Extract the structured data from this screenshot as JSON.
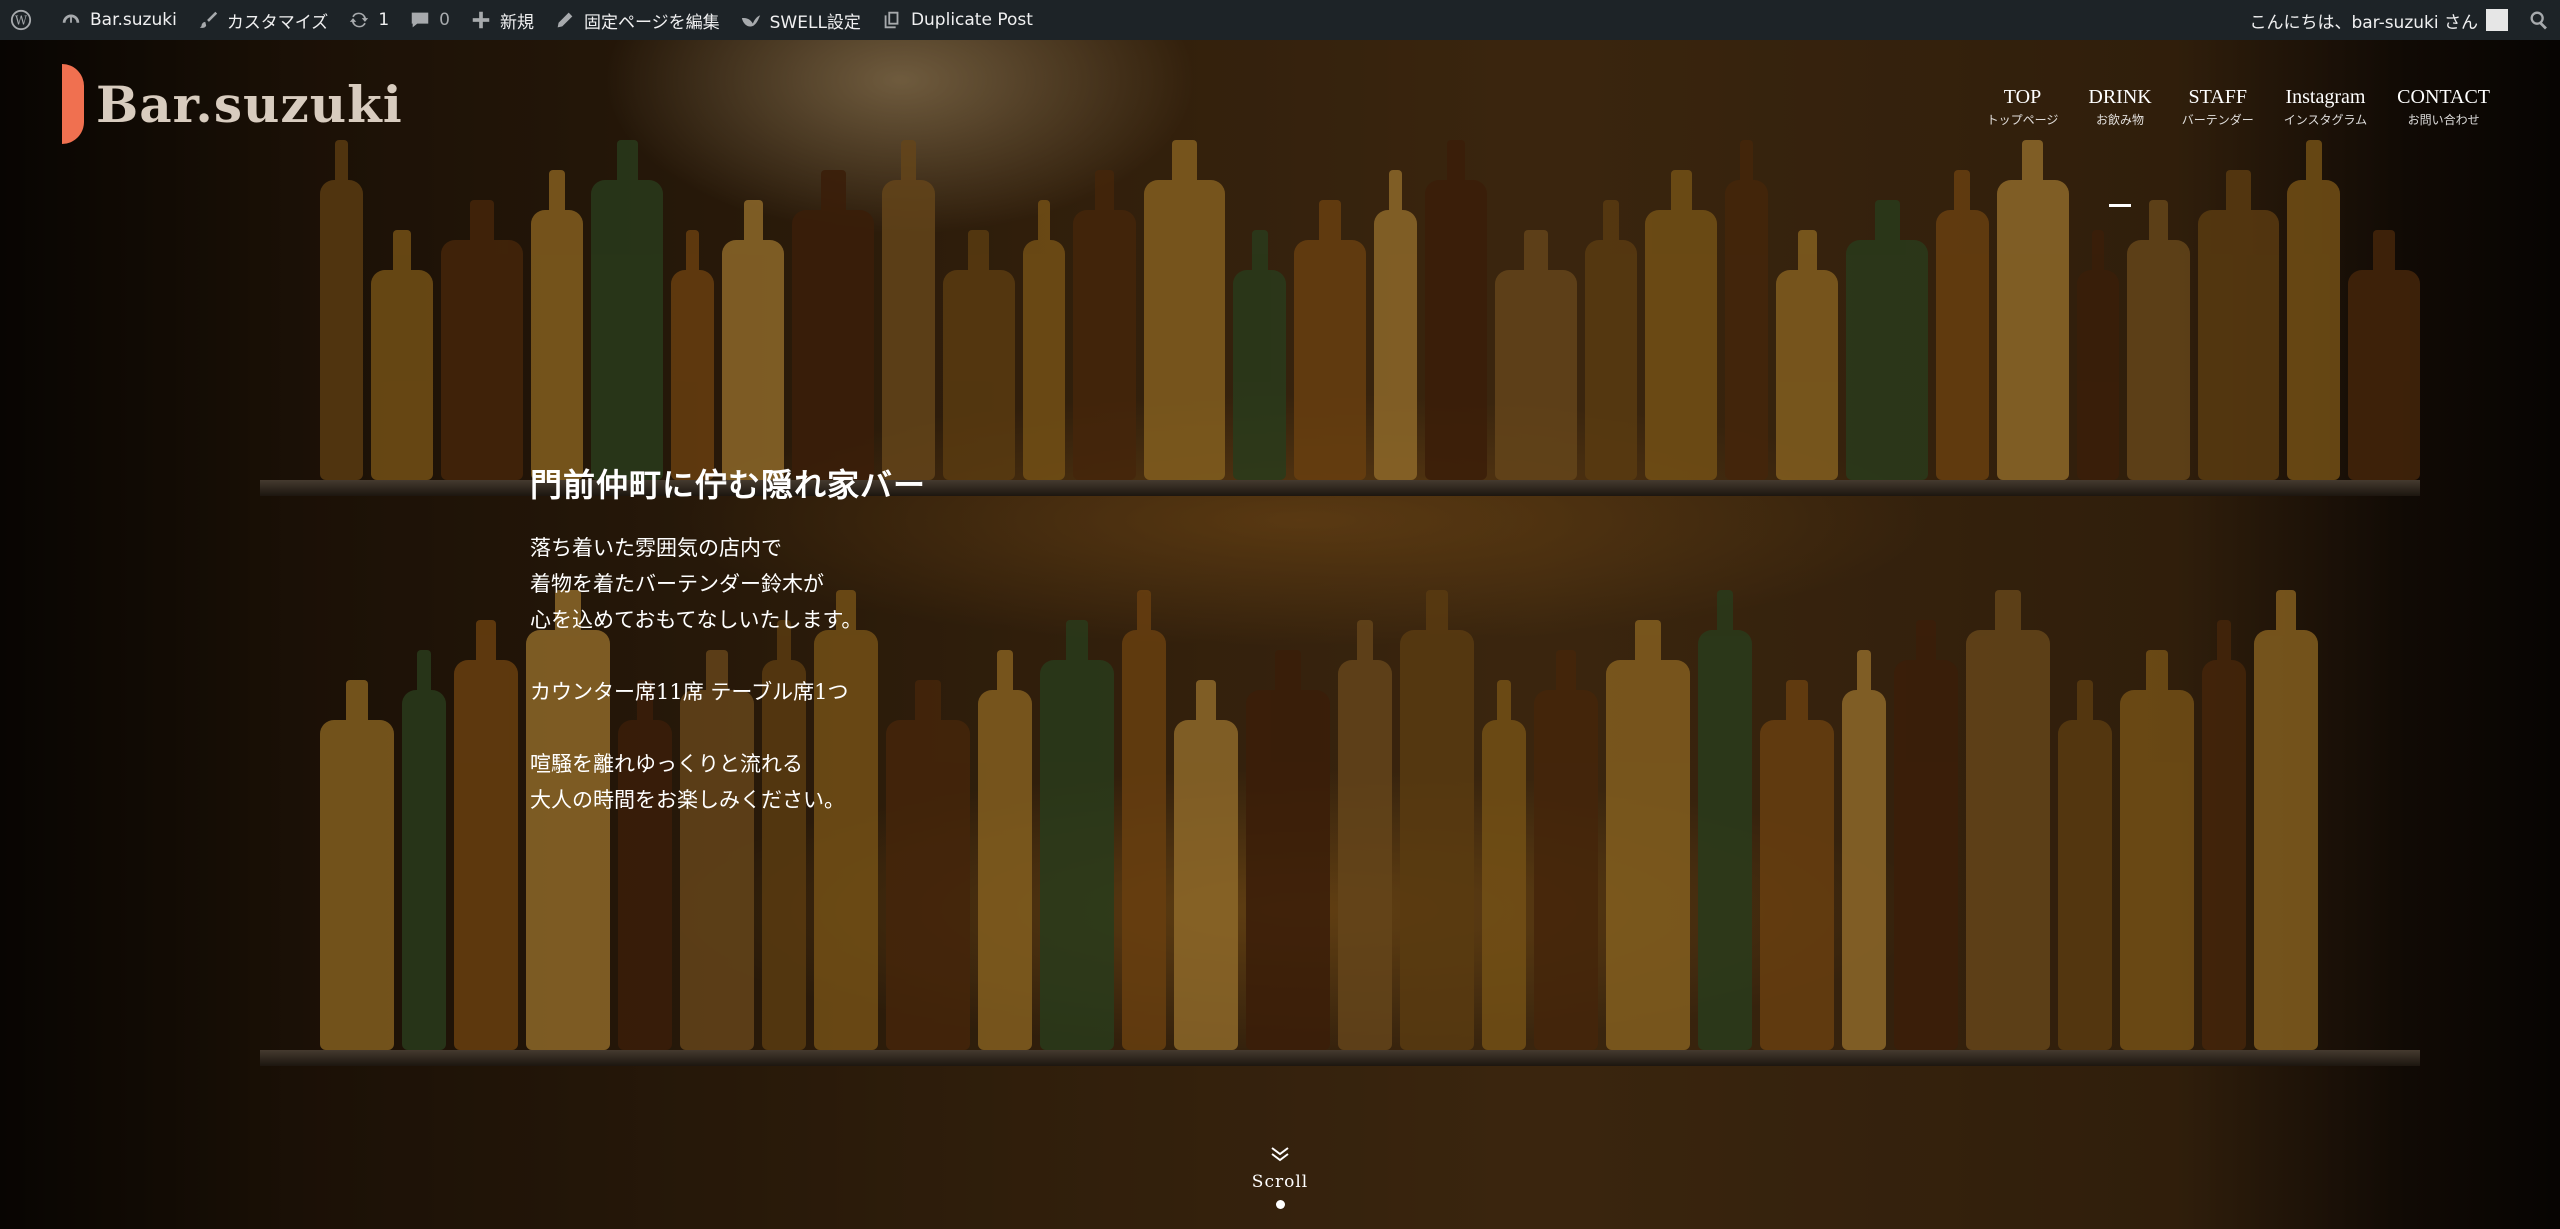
{
  "adminbar": {
    "items": [
      {
        "name": "wp-logo",
        "icon": "wordpress-icon",
        "label": ""
      },
      {
        "name": "site-name",
        "icon": "dashboard-icon",
        "label": "Bar.suzuki"
      },
      {
        "name": "customize",
        "icon": "brush-icon",
        "label": "カスタマイズ"
      },
      {
        "name": "updates",
        "icon": "update-icon",
        "label": "1"
      },
      {
        "name": "comments",
        "icon": "comment-icon",
        "label": "0"
      },
      {
        "name": "new-content",
        "icon": "plus-icon",
        "label": "新規"
      },
      {
        "name": "edit-page",
        "icon": "pencil-icon",
        "label": "固定ページを編集"
      },
      {
        "name": "swell-settings",
        "icon": "bird-icon",
        "label": "SWELL設定"
      },
      {
        "name": "duplicate-post",
        "icon": "duplicate-icon",
        "label": "Duplicate Post"
      }
    ],
    "greeting": "こんにちは、bar-suzuki さん"
  },
  "header": {
    "logo_text": "Bar.suzuki",
    "nav": [
      {
        "en": "TOP",
        "ja": "トップページ",
        "active": false
      },
      {
        "en": "DRINK",
        "ja": "お飲み物",
        "active": true
      },
      {
        "en": "STAFF",
        "ja": "バーテンダー",
        "active": false
      },
      {
        "en": "Instagram",
        "ja": "インスタグラム",
        "active": false
      },
      {
        "en": "CONTACT",
        "ja": "お問い合わせ",
        "active": false
      }
    ]
  },
  "hero": {
    "title": "門前仲町に佇む隠れ家バー",
    "paragraphs": [
      [
        "落ち着いた雰囲気の店内で",
        "着物を着たバーテンダー鈴木が",
        "心を込めておもてなしいたします。"
      ],
      [
        "カウンター席11席 テーブル席1つ"
      ],
      [
        "喧騒を離れゆっくりと流れる",
        "大人の時間をお楽しみください。"
      ]
    ],
    "scroll_label": "Scroll"
  },
  "colors": {
    "adminbar_bg": "#1d2327",
    "logo_accent": "#f07050",
    "logo_text": "#d8ccbf"
  }
}
